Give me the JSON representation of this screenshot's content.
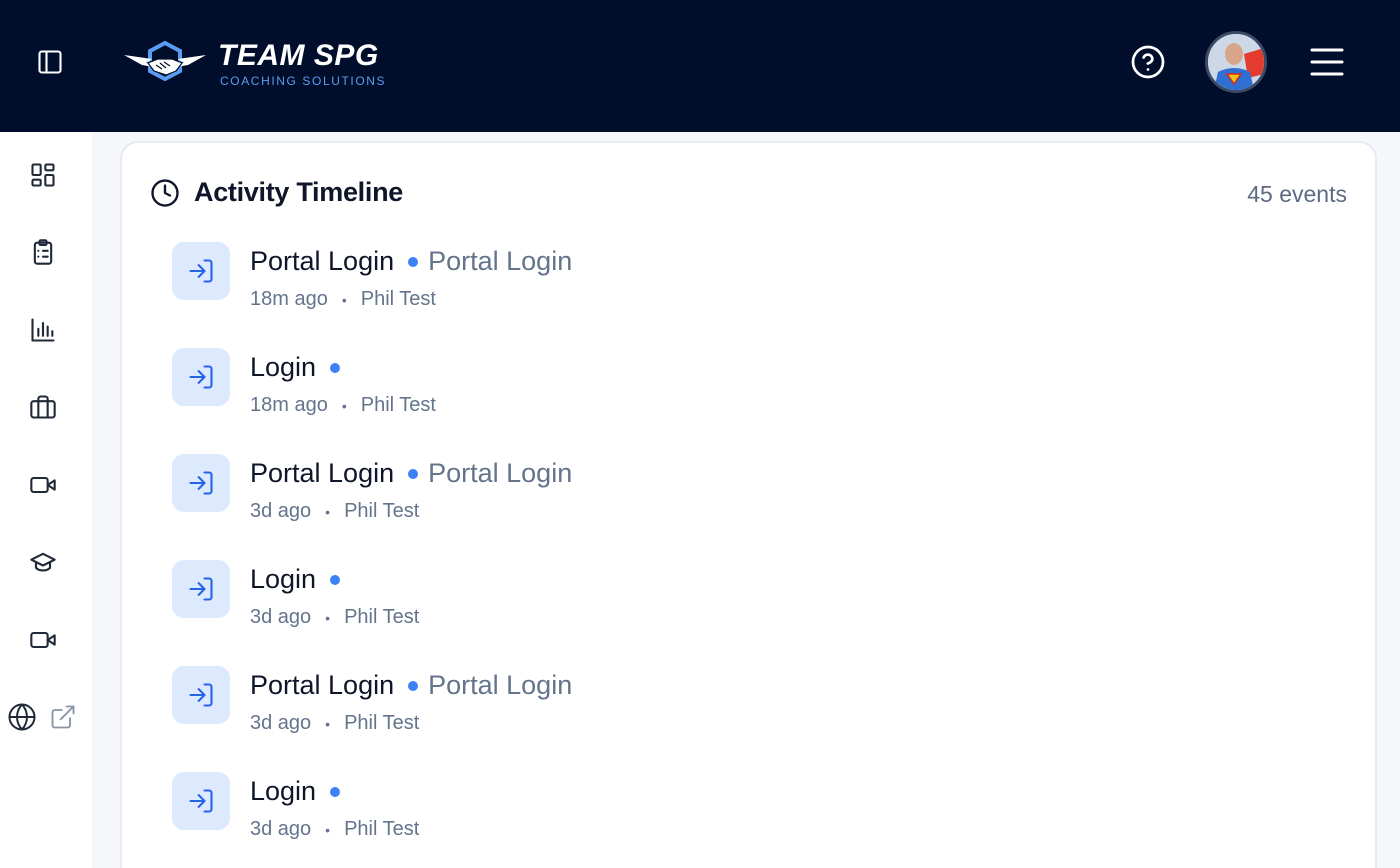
{
  "header": {
    "logo_title": "TEAM SPG",
    "logo_subtitle": "COACHING SOLUTIONS",
    "colors": {
      "background": "#010e2b",
      "accent": "#5b9cf0"
    },
    "icons": [
      "sidebar-toggle-icon",
      "help-circle-icon",
      "avatar",
      "hamburger-menu-icon"
    ]
  },
  "sidebar": {
    "items": [
      {
        "icon": "dashboard-grid-icon"
      },
      {
        "icon": "clipboard-list-icon"
      },
      {
        "icon": "bar-chart-icon"
      },
      {
        "icon": "briefcase-icon"
      },
      {
        "icon": "video-camera-icon"
      },
      {
        "icon": "graduation-cap-icon"
      },
      {
        "icon": "video-camera-icon"
      }
    ],
    "footer_icons": [
      "globe-icon",
      "external-link-icon"
    ]
  },
  "timeline": {
    "title": "Activity Timeline",
    "events_count": "45 events",
    "accent_color": "#3b82f6",
    "items": [
      {
        "title": "Portal Login",
        "subtitle": "Portal Login",
        "time": "18m ago",
        "user": "Phil Test",
        "icon": "login-arrow-icon"
      },
      {
        "title": "Login",
        "subtitle": "",
        "time": "18m ago",
        "user": "Phil Test",
        "icon": "login-arrow-icon"
      },
      {
        "title": "Portal Login",
        "subtitle": "Portal Login",
        "time": "3d ago",
        "user": "Phil Test",
        "icon": "login-arrow-icon"
      },
      {
        "title": "Login",
        "subtitle": "",
        "time": "3d ago",
        "user": "Phil Test",
        "icon": "login-arrow-icon"
      },
      {
        "title": "Portal Login",
        "subtitle": "Portal Login",
        "time": "3d ago",
        "user": "Phil Test",
        "icon": "login-arrow-icon"
      },
      {
        "title": "Login",
        "subtitle": "",
        "time": "3d ago",
        "user": "Phil Test",
        "icon": "login-arrow-icon"
      }
    ],
    "meta_separator": "•"
  }
}
